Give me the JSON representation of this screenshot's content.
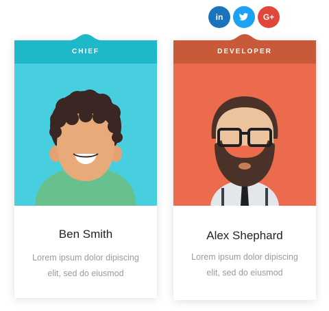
{
  "socials": {
    "linkedin": {
      "glyph": "in",
      "color": "#1a74bb",
      "icon": "linkedin-icon"
    },
    "twitter": {
      "glyph": "",
      "color": "#1da1f2",
      "icon": "twitter-icon"
    },
    "gplus": {
      "glyph": "G+",
      "color": "#e0473a",
      "icon": "google-plus-icon"
    }
  },
  "members": [
    {
      "role": "CHIEF",
      "name": "Ben Smith",
      "description": "Lorem ipsum dolor dipiscing elit, sed do eiusmod",
      "band_color": "#1fb8c8",
      "portrait_bg": "#47cfdf"
    },
    {
      "role": "DEVELOPER",
      "name": "Alex Shephard",
      "description": "Lorem ipsum dolor dipiscing elit, sed do eiusmod",
      "band_color": "#c85a3a",
      "portrait_bg": "#ec6b4c"
    }
  ]
}
